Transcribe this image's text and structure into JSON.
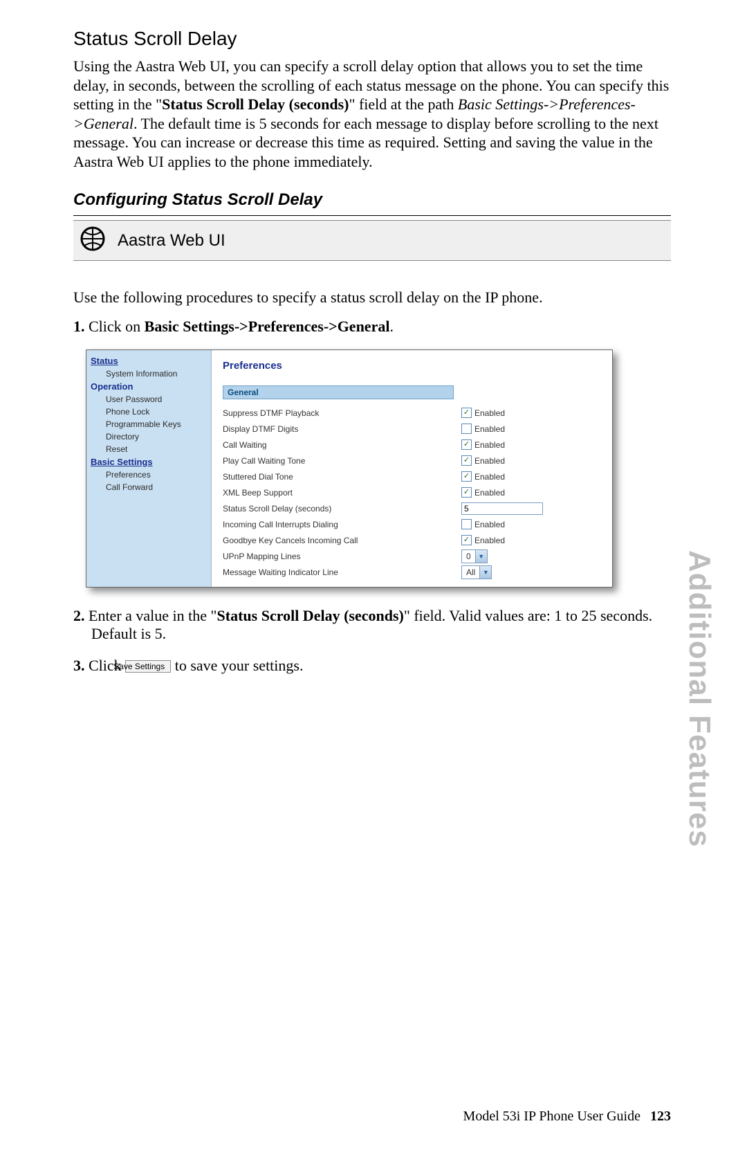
{
  "section_title": "Status Scroll Delay",
  "intro_parts": {
    "p1": "Using the Aastra Web UI, you can specify a scroll delay option that allows you to set the time delay, in seconds, between the scrolling of each status message on the phone. You can specify this setting in the \"",
    "field_name": "Status Scroll Delay (seconds)",
    "p2": "\" field at the path ",
    "path_italic": "Basic Settings->Preferences->General",
    "p3": ". The default time is 5 seconds for each message to display before scrolling to the next message. You can increase or decrease this time as required. Setting and saving the value in the Aastra Web UI applies to the phone immediately."
  },
  "subhead": "Configuring Status Scroll Delay",
  "webui_label": "Aastra Web UI",
  "instruction": "Use the following procedures to specify a status scroll delay on the IP phone.",
  "step1": {
    "num": "1.",
    "pre": " Click on ",
    "bold": "Basic Settings->Preferences->General",
    "post": "."
  },
  "step2": {
    "num": "2.",
    "pre": " Enter a value in the \"",
    "bold": "Status Scroll Delay (seconds)",
    "post": "\" field. Valid values are: 1 to 25 seconds. Default is 5."
  },
  "step3": {
    "num": "3.",
    "pre": " Click ",
    "btn": "Save Settings",
    "post": " to save your settings."
  },
  "nav": {
    "status": "Status",
    "sys_info": "System Information",
    "operation": "Operation",
    "op_items": [
      "User Password",
      "Phone Lock",
      "Programmable Keys",
      "Directory",
      "Reset"
    ],
    "basic": "Basic Settings",
    "basic_items": [
      "Preferences",
      "Call Forward"
    ]
  },
  "prefs": {
    "title": "Preferences",
    "section": "General",
    "rows": [
      {
        "label": "Suppress DTMF Playback",
        "type": "check",
        "checked": true,
        "text": "Enabled"
      },
      {
        "label": "Display DTMF Digits",
        "type": "check",
        "checked": false,
        "text": "Enabled"
      },
      {
        "label": "Call Waiting",
        "type": "check",
        "checked": true,
        "text": "Enabled"
      },
      {
        "label": "Play Call Waiting Tone",
        "type": "check",
        "checked": true,
        "text": "Enabled"
      },
      {
        "label": "Stuttered Dial Tone",
        "type": "check",
        "checked": true,
        "text": "Enabled"
      },
      {
        "label": "XML Beep Support",
        "type": "check",
        "checked": true,
        "text": "Enabled"
      },
      {
        "label": "Status Scroll Delay (seconds)",
        "type": "text",
        "value": "5"
      },
      {
        "label": "Incoming Call Interrupts Dialing",
        "type": "check",
        "checked": false,
        "text": "Enabled"
      },
      {
        "label": "Goodbye Key Cancels Incoming Call",
        "type": "check",
        "checked": true,
        "text": "Enabled"
      },
      {
        "label": "UPnP Mapping Lines",
        "type": "select",
        "value": "0"
      },
      {
        "label": "Message Waiting Indicator Line",
        "type": "select",
        "value": "All"
      }
    ]
  },
  "side_tab": "Additional Features",
  "footer_text": "Model 53i IP Phone User Guide",
  "page_number": "123"
}
